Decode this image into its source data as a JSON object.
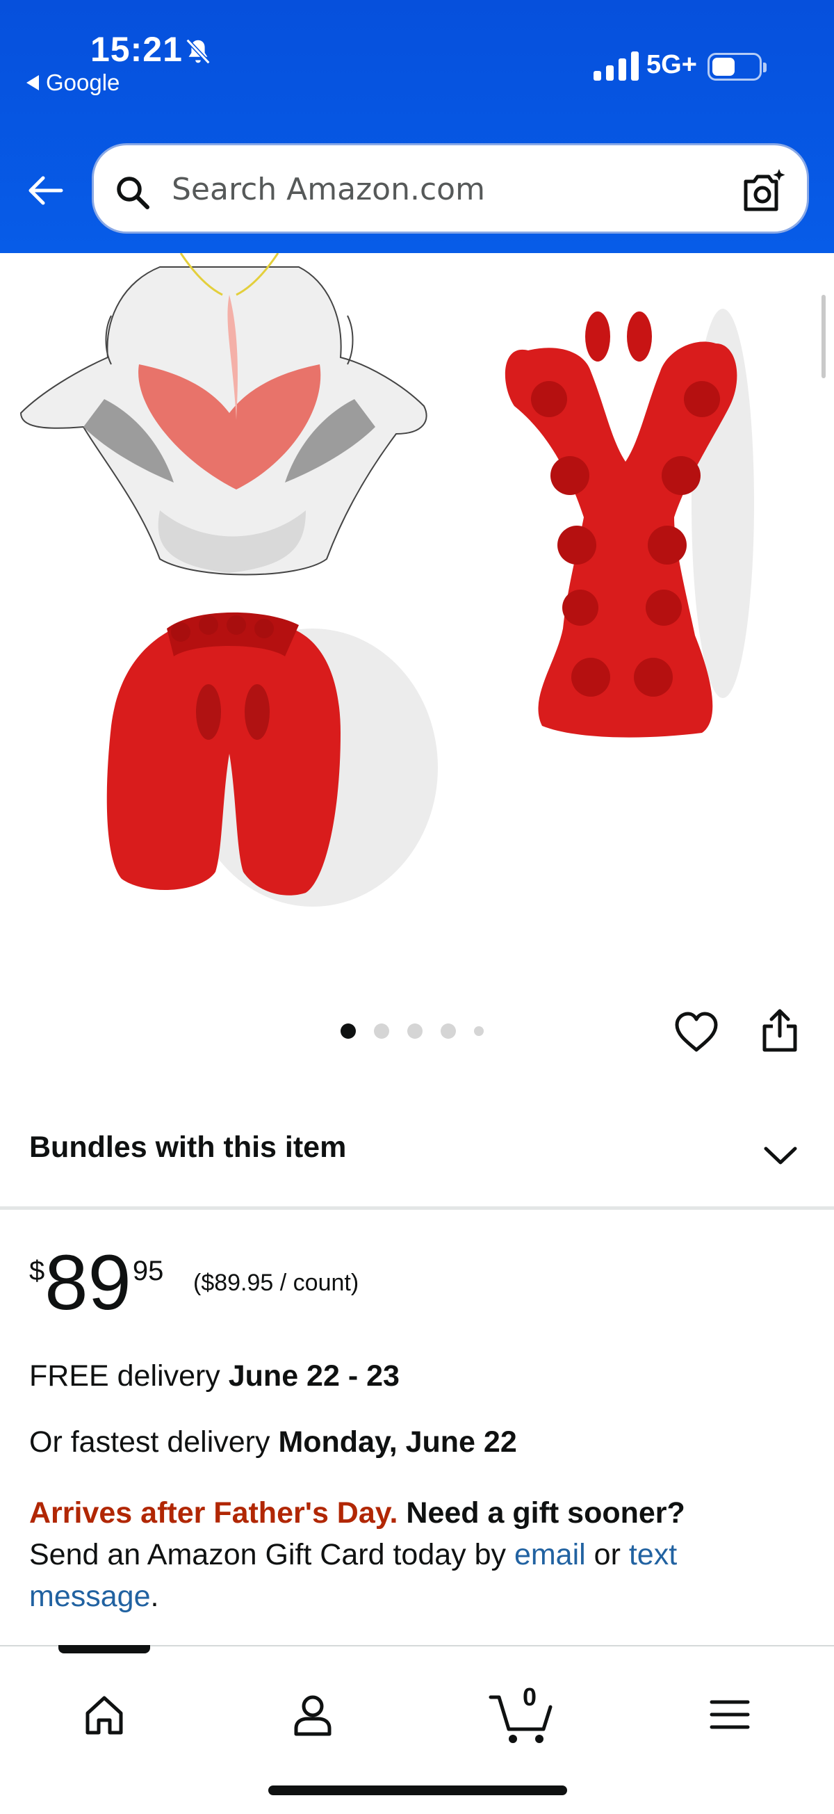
{
  "status_bar": {
    "time": "15:21",
    "back_app": "Google",
    "network": "5G+"
  },
  "search": {
    "placeholder": "Search Amazon.com"
  },
  "gallery": {
    "image_alt": "Red neck and shoulder relaxer product images",
    "dot_count": 5,
    "active_dot": 0
  },
  "bundles": {
    "title": "Bundles with this item"
  },
  "price": {
    "symbol": "$",
    "whole": "89",
    "fraction": "95",
    "per_count": "($89.95 / count)"
  },
  "delivery": {
    "free_prefix": "FREE delivery ",
    "free_dates": "June 22 - 23",
    "fast_prefix": "Or fastest delivery ",
    "fast_date": "Monday, June 22"
  },
  "gift": {
    "warning": "Arrives after Father's Day.",
    "question": " Need a gift sooner?",
    "line2_prefix": "Send an Amazon Gift Card today by ",
    "email_link": "email",
    "or_text": " or ",
    "text_link_part1": "text",
    "text_link_part2": "message",
    "period": "."
  },
  "bottom_nav": {
    "cart_count": "0",
    "items": [
      "home",
      "account",
      "cart",
      "menu"
    ]
  },
  "colors": {
    "header_blue": "#0654e0",
    "product_red": "#d91c1c",
    "warning_red": "#b12704",
    "link_blue": "#2162a1"
  }
}
